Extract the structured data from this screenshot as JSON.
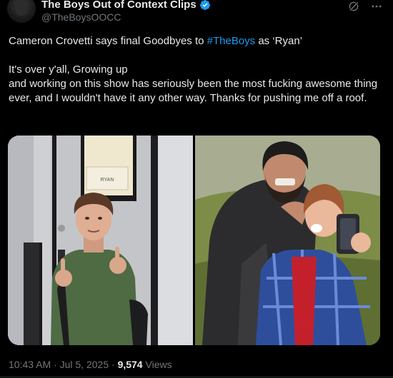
{
  "account": {
    "display_name": "The Boys Out of Context Clips",
    "handle": "@TheBoysOOCC"
  },
  "tweet": {
    "line1_prefix": "Cameron Crovetti says final Goodbyes to ",
    "hashtag": "#TheBoys",
    "line1_suffix": " as ‘Ryan’",
    "paragraph2": "It's over y'all, Growing up\nand working on this show has seriously been the most fucking awesome thing ever, and I wouldn't have it any other way. Thanks for pushing me off a roof."
  },
  "media": {
    "left_sign": "RYAN"
  },
  "meta": {
    "time": "10:43 AM",
    "separator": " · ",
    "date": "Jul 5, 2025",
    "views_count": "9,574",
    "views_label": " Views"
  },
  "colors": {
    "background": "#000000",
    "text": "#e7e9ea",
    "muted": "#71767b",
    "accent": "#1d9bf0"
  },
  "icons": [
    "verified-badge-icon",
    "grok-icon",
    "more-icon"
  ]
}
